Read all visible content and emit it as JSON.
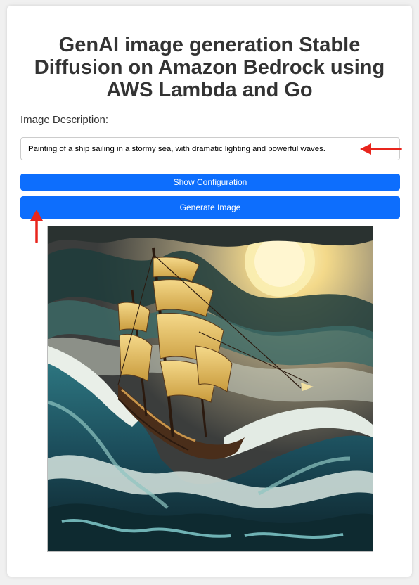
{
  "page": {
    "title": "GenAI image generation Stable Diffusion on Amazon Bedrock using AWS Lambda and Go"
  },
  "form": {
    "description_label": "Image Description:",
    "description_value": "Painting of a ship sailing in a stormy sea, with dramatic lighting and powerful waves.",
    "show_config_label": "Show Configuration",
    "generate_label": "Generate Image"
  },
  "colors": {
    "primary_button": "#0d6efd",
    "annotation_arrow": "#e8251d",
    "background": "#f0f0f0",
    "card": "#ffffff",
    "title_text": "#333333"
  },
  "icons": {
    "arrow_right": "arrow-left-icon",
    "arrow_up": "arrow-up-icon"
  }
}
